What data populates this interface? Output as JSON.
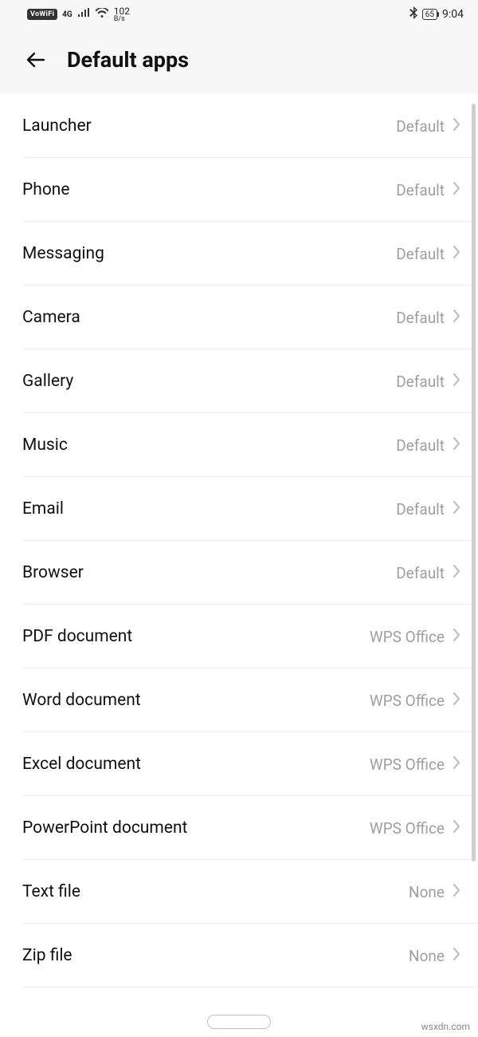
{
  "status": {
    "vowifi": "VoWiFi",
    "net_type": "4G",
    "data_rate_num": "102",
    "data_rate_unit": "B/s",
    "battery": "65",
    "time": "9:04"
  },
  "header": {
    "title": "Default apps"
  },
  "items": [
    {
      "label": "Launcher",
      "value": "Default"
    },
    {
      "label": "Phone",
      "value": "Default"
    },
    {
      "label": "Messaging",
      "value": "Default"
    },
    {
      "label": "Camera",
      "value": "Default"
    },
    {
      "label": "Gallery",
      "value": "Default"
    },
    {
      "label": "Music",
      "value": "Default"
    },
    {
      "label": "Email",
      "value": "Default"
    },
    {
      "label": "Browser",
      "value": "Default"
    },
    {
      "label": "PDF document",
      "value": "WPS Office"
    },
    {
      "label": "Word document",
      "value": "WPS Office"
    },
    {
      "label": "Excel document",
      "value": "WPS Office"
    },
    {
      "label": "PowerPoint document",
      "value": "WPS Office"
    },
    {
      "label": "Text file",
      "value": "None"
    },
    {
      "label": "Zip file",
      "value": "None"
    }
  ],
  "watermark": "wsxdn.com"
}
